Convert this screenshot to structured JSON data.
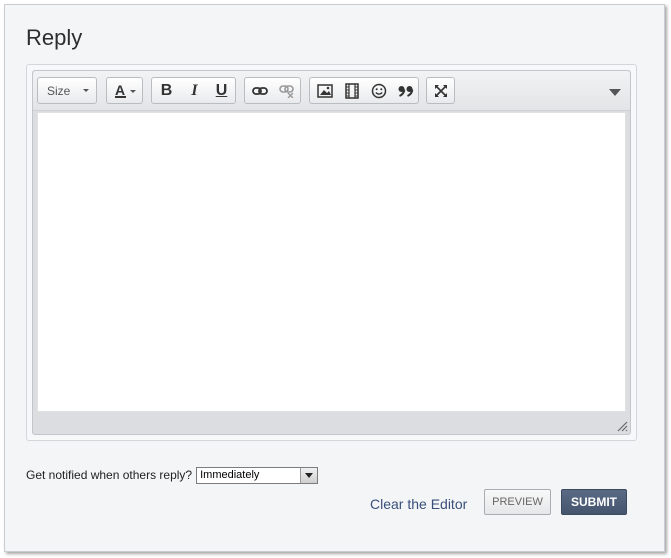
{
  "heading": "Reply",
  "toolbar": {
    "size_label": "Size",
    "buttons": [
      {
        "name": "font-color",
        "icon": "font-color-icon"
      },
      {
        "name": "bold",
        "icon": "bold-icon"
      },
      {
        "name": "italic",
        "icon": "italic-icon"
      },
      {
        "name": "underline",
        "icon": "underline-icon"
      },
      {
        "name": "link",
        "icon": "link-icon"
      },
      {
        "name": "unlink",
        "icon": "unlink-icon"
      },
      {
        "name": "image",
        "icon": "image-icon"
      },
      {
        "name": "video",
        "icon": "film-icon"
      },
      {
        "name": "emoticon",
        "icon": "smiley-icon"
      },
      {
        "name": "quote",
        "icon": "quote-icon"
      },
      {
        "name": "maximize",
        "icon": "expand-icon"
      },
      {
        "name": "more",
        "icon": "triangle-down-icon"
      }
    ]
  },
  "editor": {
    "content": ""
  },
  "notify": {
    "label": "Get notified when others reply?",
    "selected": "Immediately"
  },
  "actions": {
    "clear_label": "Clear the Editor",
    "preview_label": "PREVIEW",
    "submit_label": "SUBMIT"
  },
  "colors": {
    "link": "#3a4f7a",
    "submit_bg": "#4e5d77",
    "frame_bg": "#f3f5f7"
  }
}
